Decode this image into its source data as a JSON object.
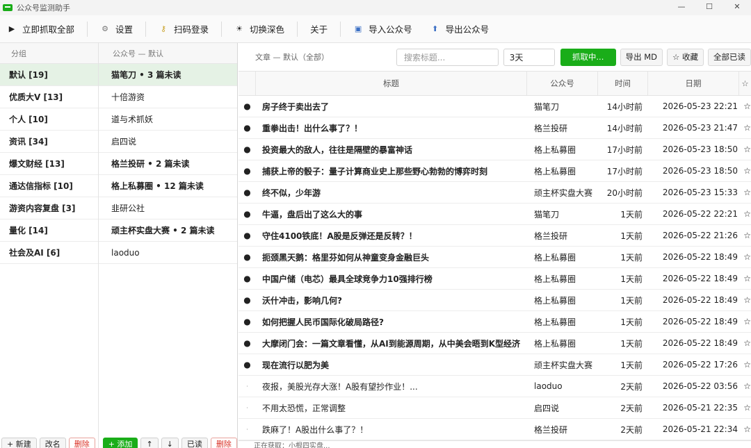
{
  "window": {
    "title": "公众号监测助手"
  },
  "toolbar": {
    "items": [
      {
        "label": "立即抓取全部",
        "icon": "play-icon"
      },
      {
        "label": "设置",
        "icon": "gear-icon"
      },
      {
        "label": "扫码登录",
        "icon": "key-icon"
      },
      {
        "label": "切换深色",
        "icon": "sun-icon"
      },
      {
        "label": "关于",
        "icon": ""
      },
      {
        "label": "导入公众号",
        "icon": "import-icon"
      },
      {
        "label": "导出公众号",
        "icon": "export-icon"
      }
    ]
  },
  "groups": {
    "header": "分组",
    "items": [
      {
        "label": "默认  [19]"
      },
      {
        "label": "优质大V  [13]"
      },
      {
        "label": "个人  [10]"
      },
      {
        "label": "资讯  [34]"
      },
      {
        "label": "爆文财经  [13]"
      },
      {
        "label": "通达信指标  [10]"
      },
      {
        "label": "游资内容复盘  [3]"
      },
      {
        "label": "量化  [14]"
      },
      {
        "label": "社会及AI  [6]"
      }
    ],
    "footer": {
      "new": "+ 新建",
      "rename": "改名",
      "delete": "删除"
    }
  },
  "accounts": {
    "header": "公众号 — 默认",
    "items": [
      {
        "label": "猫笔刀  •  3 篇未读",
        "unread": true
      },
      {
        "label": "十倍游资",
        "unread": false
      },
      {
        "label": "道与术抓妖",
        "unread": false
      },
      {
        "label": "启四说",
        "unread": false
      },
      {
        "label": "格兰投研  •  2 篇未读",
        "unread": true
      },
      {
        "label": "格上私募圈  •  12 篇未读",
        "unread": true
      },
      {
        "label": "韭研公社",
        "unread": false
      },
      {
        "label": "顽主杯实盘大赛  •  2 篇未读",
        "unread": true
      },
      {
        "label": "laoduo",
        "unread": false
      }
    ],
    "footer": {
      "add": "+ 添加",
      "up": "↑",
      "down": "↓",
      "read": "已读",
      "delete": "删除"
    }
  },
  "articles": {
    "filter_label": "文章 — 默认（全部）",
    "search_placeholder": "搜索标题...",
    "days": "3天",
    "fetch": "抓取中...",
    "export_md": "导出 MD",
    "favorite": "☆ 收藏",
    "mark_all_read": "全部已读",
    "columns": [
      "标题",
      "公众号",
      "时间",
      "日期",
      "☆"
    ],
    "rows": [
      {
        "dot": "●",
        "title": "房子终于卖出去了",
        "account": "猫笔刀",
        "ago": "14小时前",
        "date": "2026-05-23 22:21",
        "star": "☆",
        "unread": true
      },
      {
        "dot": "●",
        "title": "重拳出击！出什么事了？！",
        "account": "格兰投研",
        "ago": "14小时前",
        "date": "2026-05-23 21:47",
        "star": "☆",
        "unread": true
      },
      {
        "dot": "●",
        "title": "投资最大的敌人，往往是隔壁的暴富神话",
        "account": "格上私募圈",
        "ago": "17小时前",
        "date": "2026-05-23 18:50",
        "star": "☆",
        "unread": true
      },
      {
        "dot": "●",
        "title": "捕获上帝的骰子：量子计算商业史上那些野心勃勃的博弈时刻",
        "account": "格上私募圈",
        "ago": "17小时前",
        "date": "2026-05-23 18:50",
        "star": "☆",
        "unread": true
      },
      {
        "dot": "●",
        "title": "终不似，少年游",
        "account": "顽主杯实盘大赛",
        "ago": "20小时前",
        "date": "2026-05-23 15:33",
        "star": "☆",
        "unread": true
      },
      {
        "dot": "●",
        "title": "牛逼，盘后出了这么大的事",
        "account": "猫笔刀",
        "ago": "1天前",
        "date": "2026-05-22 22:21",
        "star": "☆",
        "unread": true
      },
      {
        "dot": "●",
        "title": "守住4100铁底！A股是反弹还是反转？！",
        "account": "格兰投研",
        "ago": "1天前",
        "date": "2026-05-22 21:26",
        "star": "☆",
        "unread": true
      },
      {
        "dot": "●",
        "title": "扼颈黑天鹅：格里芬如何从神童变身金融巨头",
        "account": "格上私募圈",
        "ago": "1天前",
        "date": "2026-05-22 18:49",
        "star": "☆",
        "unread": true
      },
      {
        "dot": "●",
        "title": "中国户储（电芯）最具全球竞争力10强排行榜",
        "account": "格上私募圈",
        "ago": "1天前",
        "date": "2026-05-22 18:49",
        "star": "☆",
        "unread": true
      },
      {
        "dot": "●",
        "title": "沃什冲击，影响几何?",
        "account": "格上私募圈",
        "ago": "1天前",
        "date": "2026-05-22 18:49",
        "star": "☆",
        "unread": true
      },
      {
        "dot": "●",
        "title": "如何把握人民币国际化破局路径?",
        "account": "格上私募圈",
        "ago": "1天前",
        "date": "2026-05-22 18:49",
        "star": "☆",
        "unread": true
      },
      {
        "dot": "●",
        "title": "大摩闭门会：一篇文章看懂，从AI到能源周期，从中美会晤到K型经济",
        "account": "格上私募圈",
        "ago": "1天前",
        "date": "2026-05-22 18:49",
        "star": "☆",
        "unread": true
      },
      {
        "dot": "●",
        "title": "现在流行以肥为美",
        "account": "顽主杯实盘大赛",
        "ago": "1天前",
        "date": "2026-05-22 17:26",
        "star": "☆",
        "unread": true
      },
      {
        "dot": "·",
        "title": "夜报，美股光存大涨！A股有望抄作业！...",
        "account": "laoduo",
        "ago": "2天前",
        "date": "2026-05-22 03:56",
        "star": "☆",
        "unread": false
      },
      {
        "dot": "·",
        "title": "不用太恐慌，正常调整",
        "account": "启四说",
        "ago": "2天前",
        "date": "2026-05-21 22:35",
        "star": "☆",
        "unread": false
      },
      {
        "dot": "·",
        "title": "跌麻了！A股出什么事了？！",
        "account": "格兰投研",
        "ago": "2天前",
        "date": "2026-05-21 22:34",
        "star": "☆",
        "unread": false
      }
    ],
    "status": "正在获取：小根四实盘..."
  },
  "colors": {
    "accent": "#1aad19",
    "selected_row": "#e5f2e5",
    "danger": "#d93025"
  }
}
